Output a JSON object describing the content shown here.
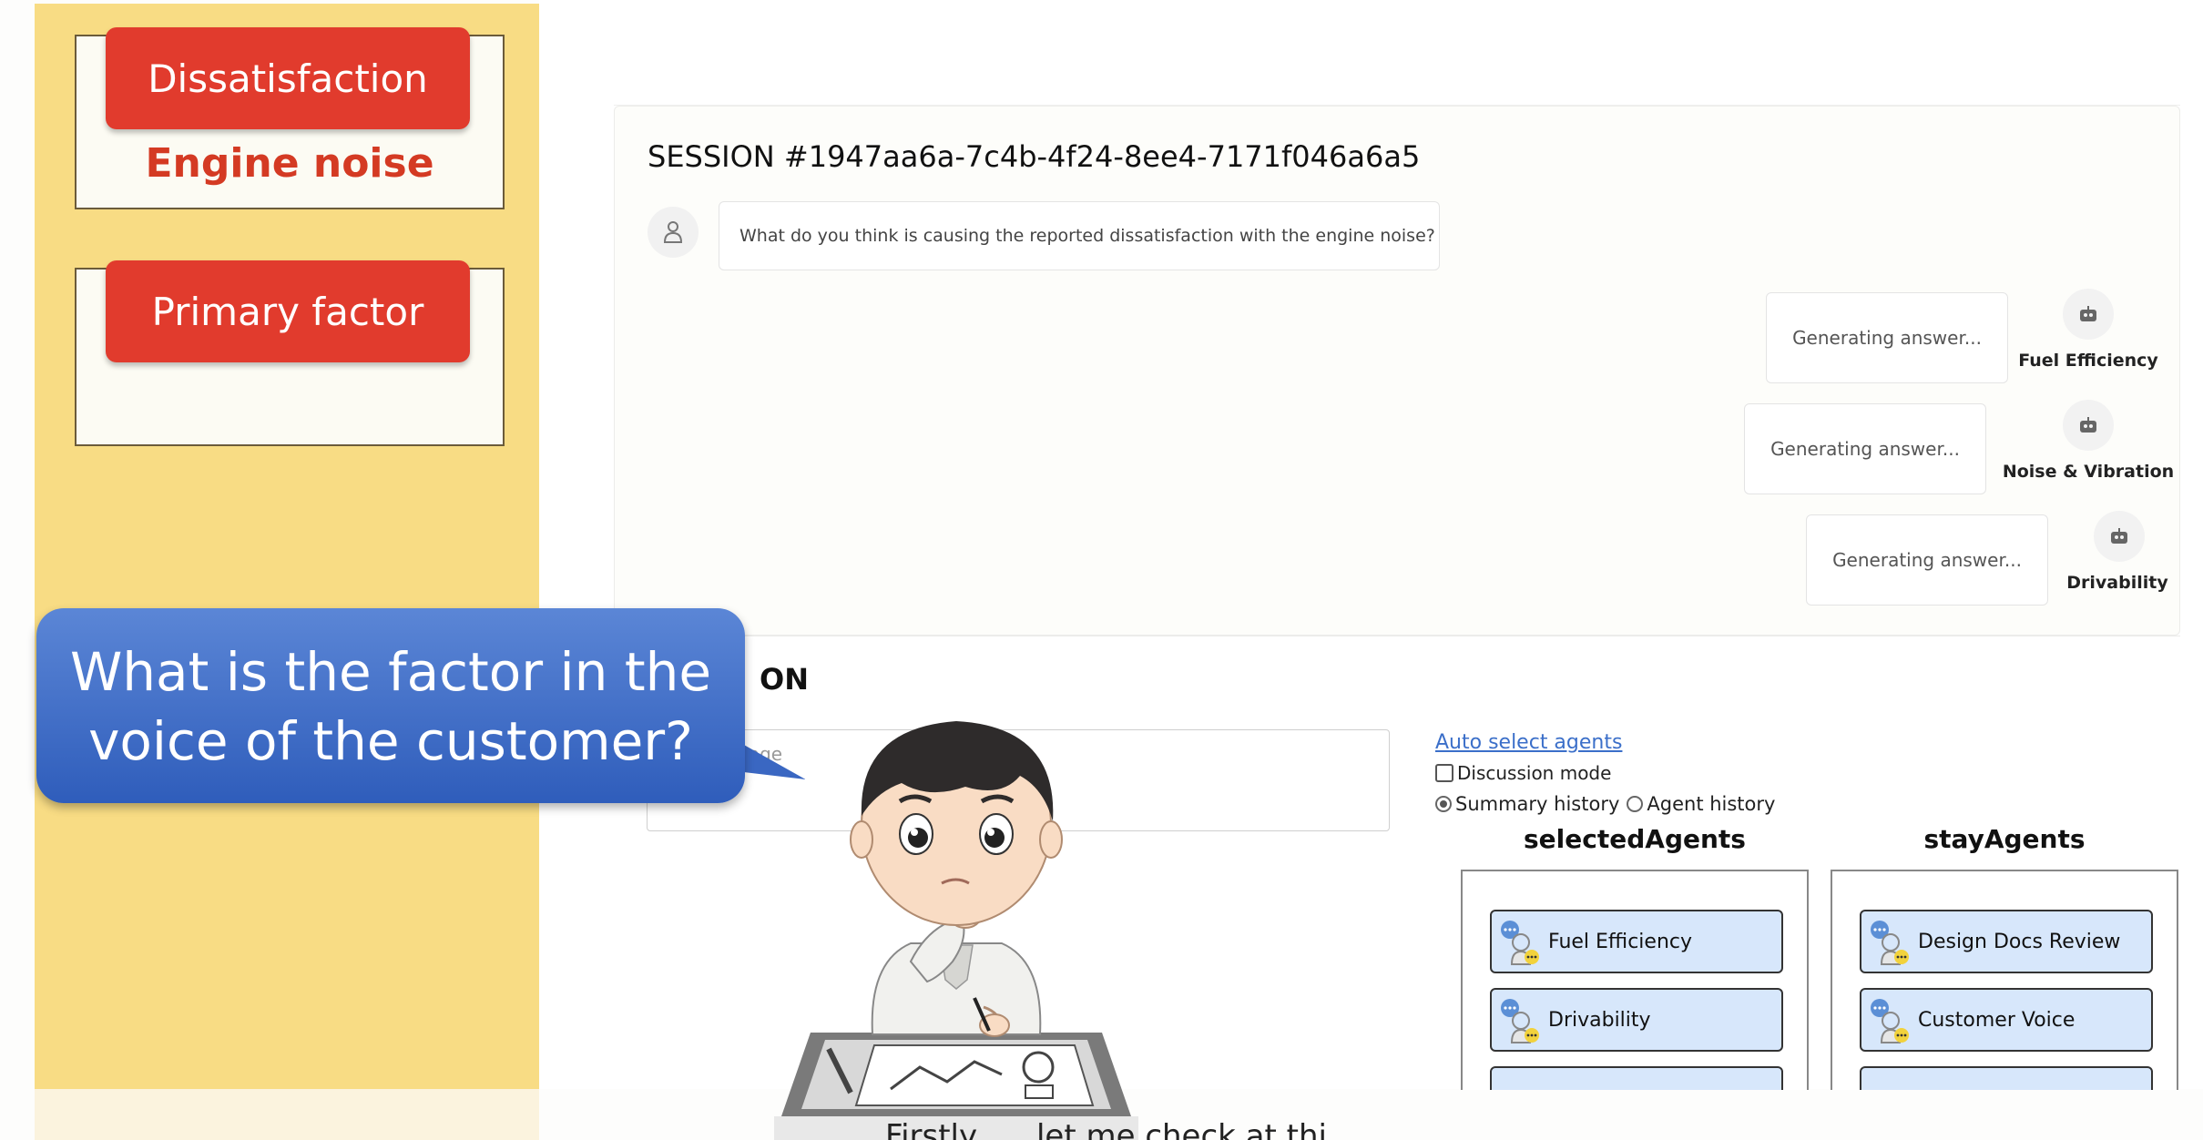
{
  "slide": {
    "card1_pill": "Dissatisfaction",
    "card1_value": "Engine noise",
    "card2_pill": "Primary factor",
    "bubble_text": "What is the factor in the voice of the customer?"
  },
  "session": {
    "title": "SESSION #1947aa6a-7c4b-4f24-8ee4-7171f046a6a5",
    "user_message": "What do you think is causing the reported dissatisfaction with the engine noise?",
    "answers": [
      {
        "status": "Generating answer...",
        "agent": "Fuel Efficiency"
      },
      {
        "status": "Generating answer...",
        "agent": "Noise & Vibration"
      },
      {
        "status": "Generating answer...",
        "agent": "Drivability"
      }
    ]
  },
  "compose": {
    "title_partial": "ON",
    "input_placeholder_partial": "ssage",
    "auto_select_label": "Auto select agents",
    "discussion_mode_label": "Discussion mode",
    "summary_history_label": "Summary history",
    "agent_history_label": "Agent history",
    "history_selected": "Summary history",
    "selected_agents_header": "selectedAgents",
    "stay_agents_header": "stayAgents",
    "selected_agents": [
      "Fuel Efficiency",
      "Drivability"
    ],
    "stay_agents": [
      "Design Docs Review",
      "Customer Voice"
    ]
  },
  "caption": "Firstly, ... let me check at thi...",
  "colors": {
    "pill_red": "#e13b2d",
    "panel_yellow": "#f8dc84",
    "bubble_blue": "#2f5dbb",
    "link_blue": "#3b6fc9",
    "agent_btn_fill": "#d7e7fb"
  },
  "icons": [
    "user-icon",
    "robot-icon",
    "agent-chat-icon"
  ]
}
